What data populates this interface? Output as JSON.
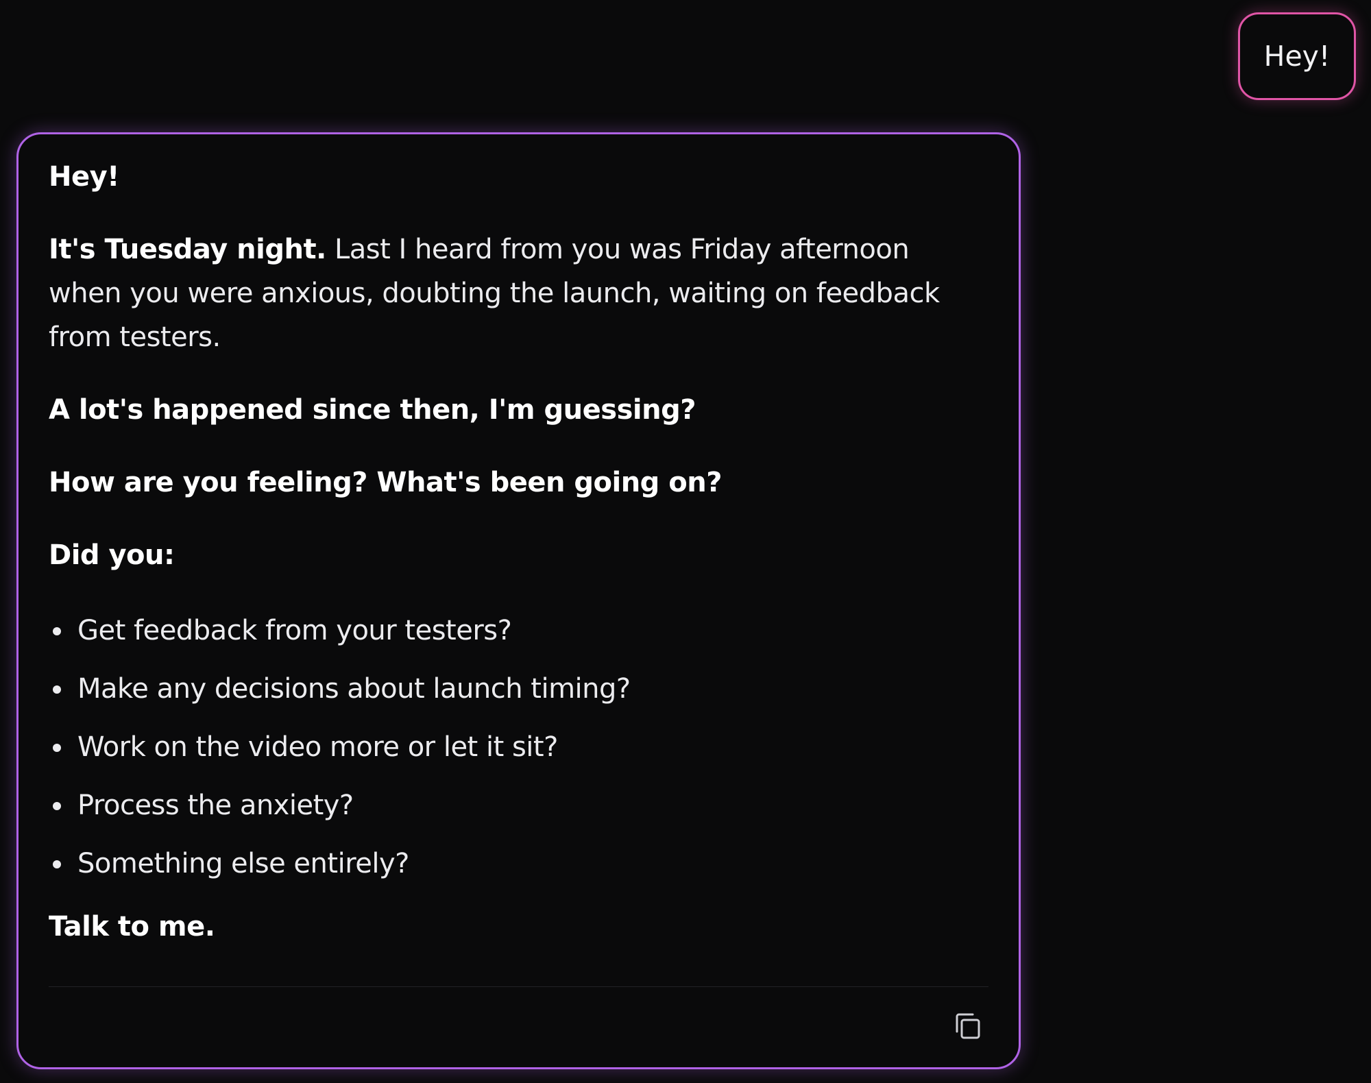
{
  "user_message": {
    "text": "Hey!"
  },
  "assistant_message": {
    "greeting": "Hey!",
    "intro_bold": "It's Tuesday night.",
    "intro_rest": " Last I heard from you was Friday afternoon when you were anxious, doubting the launch, waiting on feedback from testers.",
    "line_2": "A lot's happened since then, I'm guessing?",
    "line_3": "How are you feeling? What's been going on?",
    "list_heading": "Did you:",
    "items": [
      "Get feedback from your testers?",
      "Make any decisions about launch timing?",
      "Work on the video more or let it sit?",
      "Process the anxiety?",
      "Something else entirely?"
    ],
    "closing": "Talk to me."
  },
  "actions": {
    "copy_icon": "copy-icon"
  },
  "colors": {
    "background": "#0a0a0b",
    "user_bubble_border": "#e055a6",
    "assistant_border": "#b063e6",
    "text": "#ececef"
  }
}
